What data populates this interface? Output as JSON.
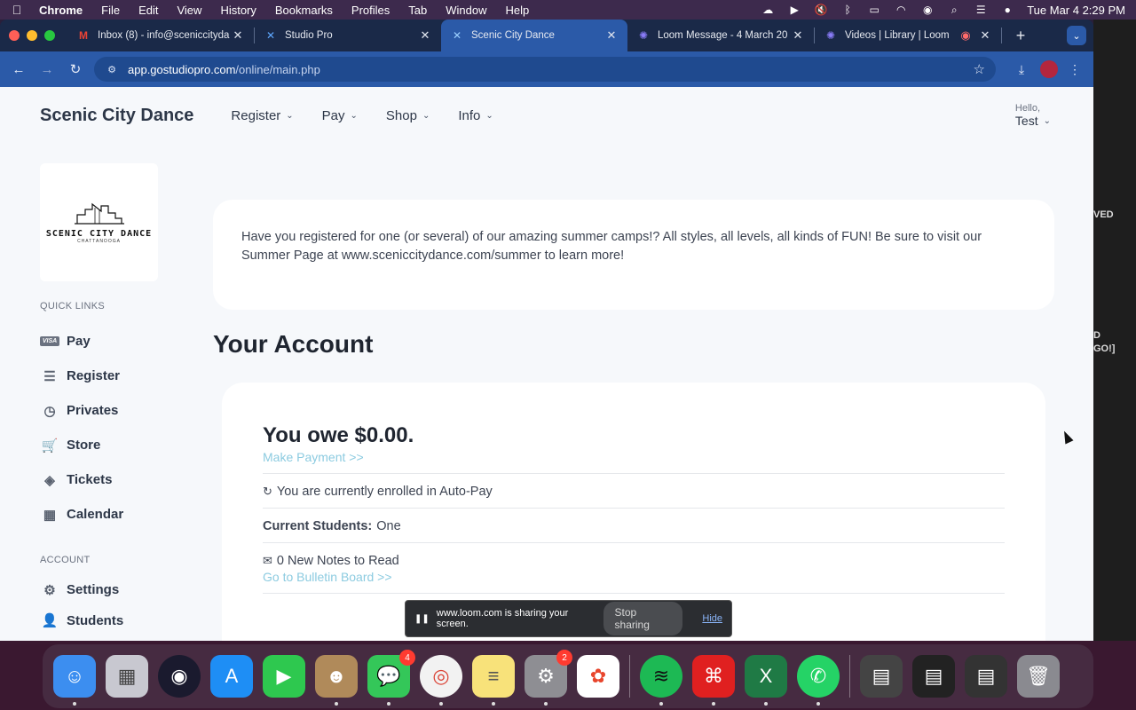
{
  "menubar": {
    "apple_icon": "apple-icon",
    "items": [
      "Chrome",
      "File",
      "Edit",
      "View",
      "History",
      "Bookmarks",
      "Profiles",
      "Tab",
      "Window",
      "Help"
    ],
    "datetime": "Tue Mar 4  2:29 PM"
  },
  "desktop_side": {
    "text1": "VED",
    "text2": "D",
    "text3": "GO!]"
  },
  "tabs": [
    {
      "label": "Inbox (8) - info@sceniccityda",
      "icon": "gmail-icon"
    },
    {
      "label": "Studio Pro",
      "icon": "studio-pro-icon"
    },
    {
      "label": "Scenic City Dance",
      "icon": "studio-pro-icon"
    },
    {
      "label": "Loom Message - 4 March 20",
      "icon": "loom-icon"
    },
    {
      "label": "Videos | Library | Loom",
      "icon": "loom-icon"
    }
  ],
  "address_bar": {
    "host": "app.gostudiopro.com",
    "path": "/online/main.php"
  },
  "site": {
    "brand": "Scenic City Dance",
    "nav": [
      "Register",
      "Pay",
      "Shop",
      "Info"
    ],
    "user_greeting": "Hello,",
    "user_name": "Test",
    "logo_title": "SCENIC CITY DANCE",
    "logo_sub": "CHATTANOOGA"
  },
  "sidebar": {
    "quick_links_label": "QUICK LINKS",
    "quick_links": [
      {
        "label": "Pay",
        "icon": "visa-card-icon"
      },
      {
        "label": "Register",
        "icon": "list-icon"
      },
      {
        "label": "Privates",
        "icon": "clock-icon"
      },
      {
        "label": "Store",
        "icon": "cart-icon"
      },
      {
        "label": "Tickets",
        "icon": "ticket-icon"
      },
      {
        "label": "Calendar",
        "icon": "calendar-icon"
      }
    ],
    "account_label": "ACCOUNT",
    "account_links": [
      {
        "label": "Settings",
        "icon": "gear-icon"
      },
      {
        "label": "Students",
        "icon": "user-icon"
      }
    ]
  },
  "banner": {
    "text": "Have you registered for one (or several) of our amazing summer camps!? All styles, all levels, all kinds of FUN! Be sure to visit our Summer Page at www.sceniccitydance.com/summer to learn more!"
  },
  "account": {
    "title": "Your Account",
    "owe": "You owe $0.00.",
    "make_payment": "Make Payment >>",
    "autopay": "You are currently enrolled in Auto-Pay",
    "students_label": "Current Students:",
    "students_value": "One",
    "notes": "0 New Notes to Read",
    "bulletin": "Go to Bulletin Board >>"
  },
  "sharebar": {
    "message": "www.loom.com is sharing your screen.",
    "stop": "Stop sharing",
    "hide": "Hide"
  },
  "dock": {
    "apps": [
      "finder",
      "launchpad",
      "siri",
      "app-store",
      "facetime",
      "contacts",
      "messages",
      "chrome",
      "notes",
      "system-settings",
      "photos",
      "spotify",
      "acrobat",
      "excel",
      "whatsapp"
    ],
    "messages_badge": "4",
    "settings_badge": "2"
  }
}
